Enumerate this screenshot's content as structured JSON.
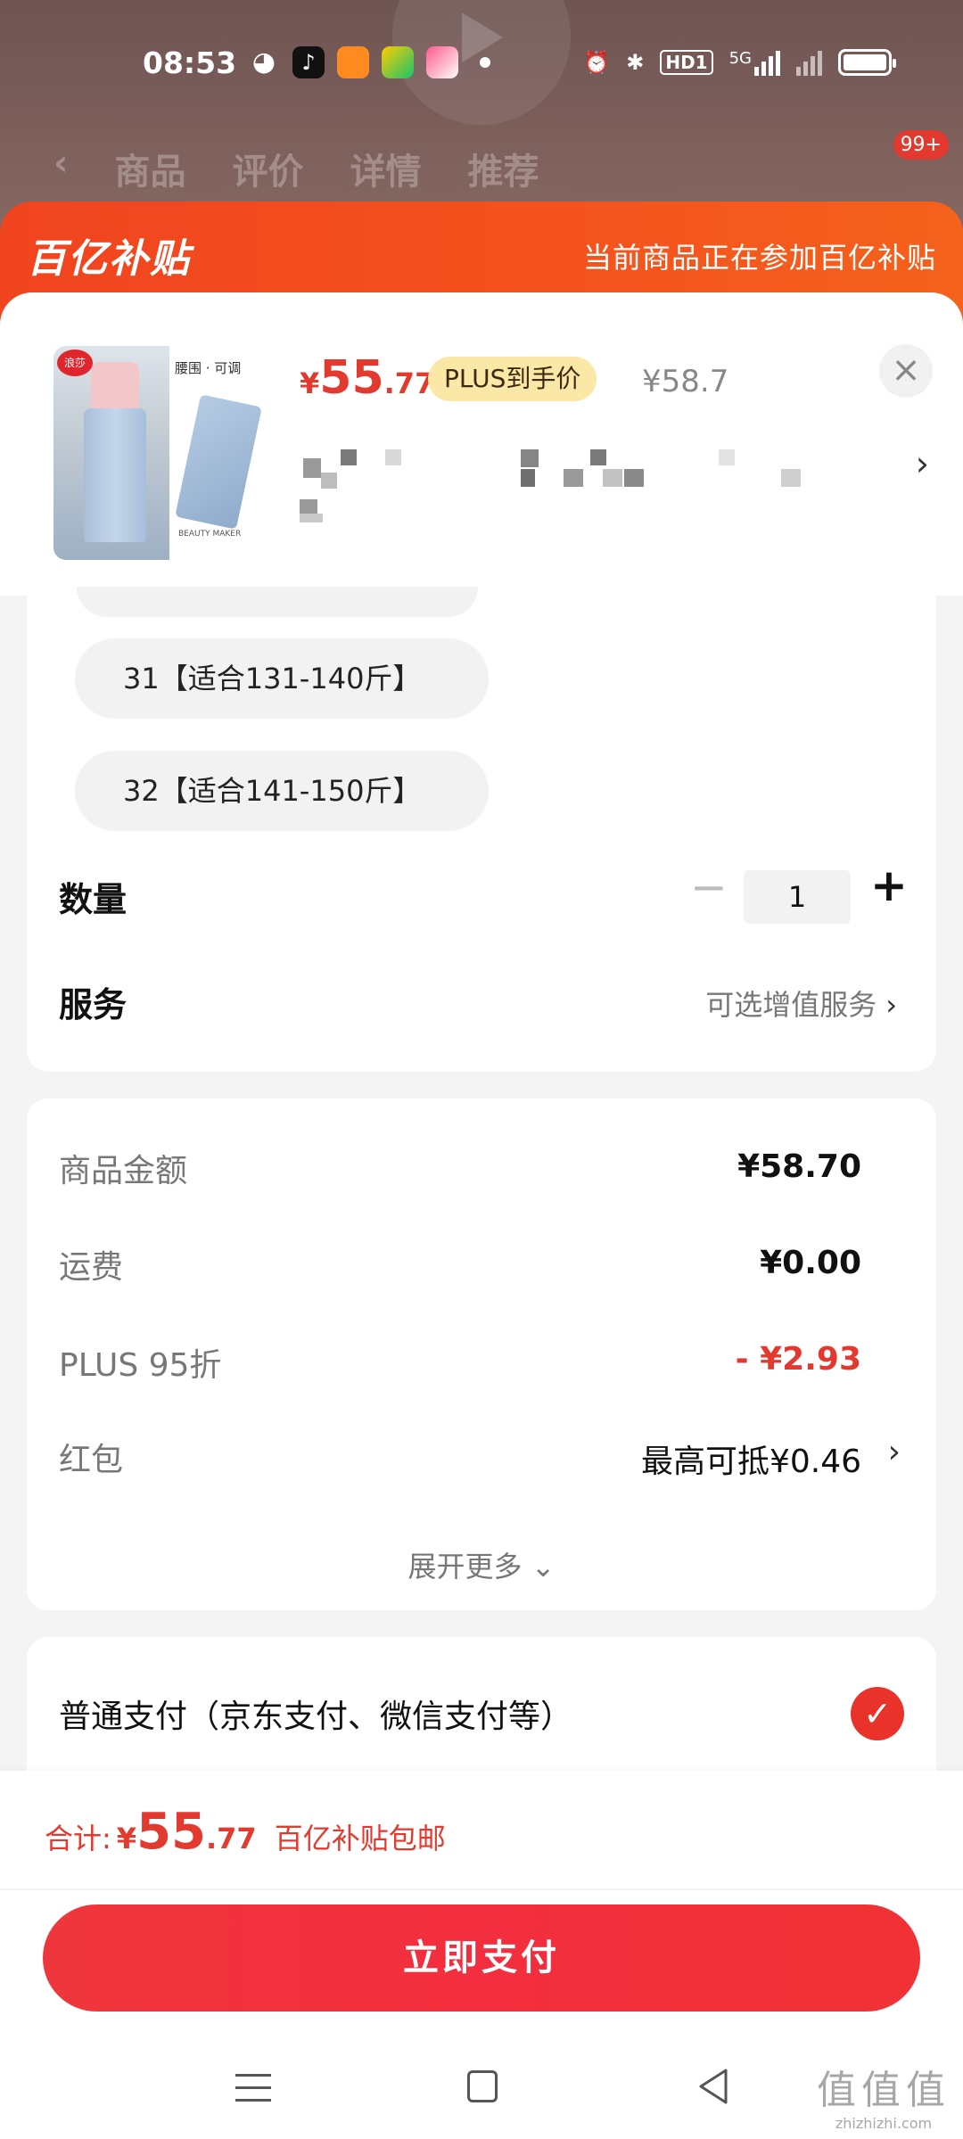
{
  "status_bar": {
    "time": "08:53",
    "hd": "HD1",
    "network": "5G"
  },
  "bg_tabs": [
    "商品",
    "评价",
    "详情",
    "推荐"
  ],
  "bg_badge": "99+",
  "subsidy": {
    "logo": "百亿补贴",
    "text": "当前商品正在参加百亿补贴"
  },
  "product": {
    "thumb_caption": "腰围 · 可调",
    "thumb_footer": "BEAUTY MAKER",
    "thumb_logo": "浪莎",
    "price_symbol": "¥",
    "price_int": "55",
    "price_dec": ".77",
    "plus_tag": "PLUS到手价",
    "original_price": "¥58.7",
    "close": "×"
  },
  "sizes": [
    {
      "label": "31【适合131-140斤】"
    },
    {
      "label": "32【适合141-150斤】"
    }
  ],
  "quantity": {
    "label": "数量",
    "minus": "−",
    "value": "1",
    "plus": "+"
  },
  "service": {
    "label": "服务",
    "link": "可选增值服务"
  },
  "details": {
    "rows": [
      {
        "label": "商品金额",
        "value": "¥58.70",
        "red": false
      },
      {
        "label": "运费",
        "value": "¥0.00",
        "red": false
      },
      {
        "label": "PLUS 95折",
        "value": "- ¥2.93",
        "red": true
      },
      {
        "label": "红包",
        "value": "最高可抵¥0.46",
        "red": false
      }
    ],
    "expand": "展开更多"
  },
  "payment": {
    "label": "普通支付（京东支付、微信支付等）",
    "check": "✓"
  },
  "total": {
    "label": "合计:",
    "symbol": "¥",
    "int": "55",
    "dec": ".77",
    "note": "百亿补贴包邮"
  },
  "pay_button": "立即支付",
  "watermark": {
    "big": "值值值",
    "small": "zhizhizhi.com"
  },
  "colors": {
    "accent": "#e23a2f",
    "banner": "#f0441f",
    "plus_tag": "#fbe7a6"
  }
}
